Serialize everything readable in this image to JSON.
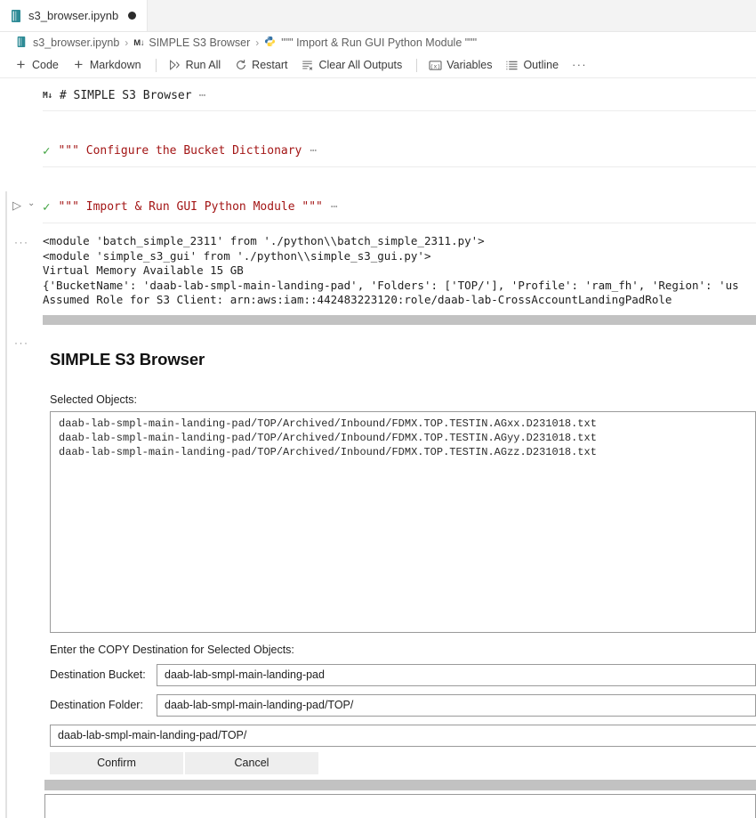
{
  "window": {
    "tab": {
      "filename": "s3_browser.ipynb",
      "icon": "notebook-icon",
      "dirty": "●"
    }
  },
  "breadcrumb": {
    "items": [
      {
        "label": "s3_browser.ipynb",
        "icon": "notebook-icon"
      },
      {
        "label": "SIMPLE S3 Browser",
        "icon": "markdown-icon",
        "badge": "M↓"
      },
      {
        "label": "\"\"\" Import & Run GUI Python Module \"\"\"",
        "icon": "python-icon"
      }
    ],
    "separator": "›"
  },
  "toolbar": {
    "add_code": "Code",
    "add_markdown": "Markdown",
    "run_all": "Run All",
    "restart": "Restart",
    "clear_all_outputs": "Clear All Outputs",
    "variables": "Variables",
    "outline": "Outline",
    "more": "···"
  },
  "cells": [
    {
      "kind": "markdown",
      "badge": "M↓",
      "source": "# SIMPLE S3 Browser",
      "ellipsis": "⋯"
    },
    {
      "kind": "code",
      "status": "✓",
      "source": "\"\"\" Configure the Bucket Dictionary",
      "ellipsis": "⋯"
    },
    {
      "kind": "code",
      "status": "✓",
      "source": "\"\"\" Import & Run GUI Python Module \"\"\"",
      "ellipsis": "⋯",
      "run_icon": "▷",
      "collapse_icon": "⌄"
    }
  ],
  "output": {
    "gutter_dots": "···",
    "lines": [
      "<module 'batch_simple_2311' from './python\\\\batch_simple_2311.py'>",
      "<module 'simple_s3_gui' from './python\\\\simple_s3_gui.py'>",
      "Virtual Memory Available 15 GB",
      "{'BucketName': 'daab-lab-smpl-main-landing-pad', 'Folders': ['TOP/'], 'Profile': 'ram_fh', 'Region': 'us",
      "Assumed Role for S3 Client: arn:aws:iam::442483223120:role/daab-lab-CrossAccountLandingPadRole"
    ]
  },
  "gui": {
    "gutter_dots": "···",
    "title": "SIMPLE S3 Browser",
    "selected_objects_label": "Selected Objects:",
    "selected_objects": [
      "daab-lab-smpl-main-landing-pad/TOP/Archived/Inbound/FDMX.TOP.TESTIN.AGxx.D231018.txt",
      "daab-lab-smpl-main-landing-pad/TOP/Archived/Inbound/FDMX.TOP.TESTIN.AGyy.D231018.txt",
      "daab-lab-smpl-main-landing-pad/TOP/Archived/Inbound/FDMX.TOP.TESTIN.AGzz.D231018.txt"
    ],
    "copy_destination_label": "Enter the COPY Destination for Selected Objects:",
    "destination_bucket_label": "Destination Bucket:",
    "destination_bucket_value": "daab-lab-smpl-main-landing-pad",
    "destination_folder_label": "Destination Folder:",
    "destination_folder_value": "daab-lab-smpl-main-landing-pad/TOP/",
    "path_preview_value": "daab-lab-smpl-main-landing-pad/TOP/",
    "confirm_label": "Confirm",
    "cancel_label": "Cancel"
  },
  "colors": {
    "tab_active_bg": "#ffffff",
    "tabbar_bg": "#f3f3f3",
    "string_red": "#a31515",
    "success_green": "#3fa23f",
    "scrollbar_gray": "#c2c2c2",
    "button_gray": "#eeeeee"
  }
}
